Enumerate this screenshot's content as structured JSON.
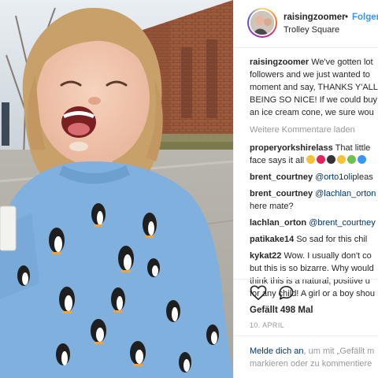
{
  "header": {
    "username": "raisingzoomer",
    "separator": "•",
    "follow_label": "Folgen",
    "location": "Trolley Square"
  },
  "caption": {
    "username": "raisingzoomer",
    "line1": "We've gotten lot",
    "line2": "followers and we just wanted to",
    "line3": "moment and say, THANKS Y'ALL",
    "line4": "BEING SO NICE! If we could buy",
    "line5": "an ice cream cone, we sure wou"
  },
  "load_more": "Weitere Kommentare laden",
  "comments": [
    {
      "username": "properyorkshirelass",
      "line1": "That little",
      "line2": "face says it all"
    },
    {
      "username": "brent_courtney",
      "mention": "@orto1oli",
      "line1": "pleas"
    },
    {
      "username": "brent_courtney",
      "mention": "@lachlan_orton",
      "line2": "here mate?"
    },
    {
      "username": "lachlan_orton",
      "mention": "@brent_courtney"
    },
    {
      "username": "patikake14",
      "line1": "So sad for this chil"
    },
    {
      "username": "kykat22",
      "line1": "Wow. I usually don't co",
      "line2": "but this is so bizarre. Why would",
      "line3": "think this is a natural, positive u",
      "line4": "for any child! A girl or a boy shou"
    }
  ],
  "emoji_colors": [
    "#f7c23b",
    "#e0245e",
    "#333333",
    "#f7c23b",
    "#6cc24a",
    "#3897f0"
  ],
  "icons": {
    "like": "heart-icon",
    "comment": "comment-bubble-icon"
  },
  "likes_label": "Gefällt 498 Mal",
  "date_label": "10. APRIL",
  "login_prompt": {
    "link": "Melde dich an",
    "rest1": ", um mit „Gefällt m",
    "line2": "markieren oder zu kommentiere"
  },
  "colors": {
    "link": "#3897f0",
    "mention": "#003569",
    "muted": "#999999"
  }
}
